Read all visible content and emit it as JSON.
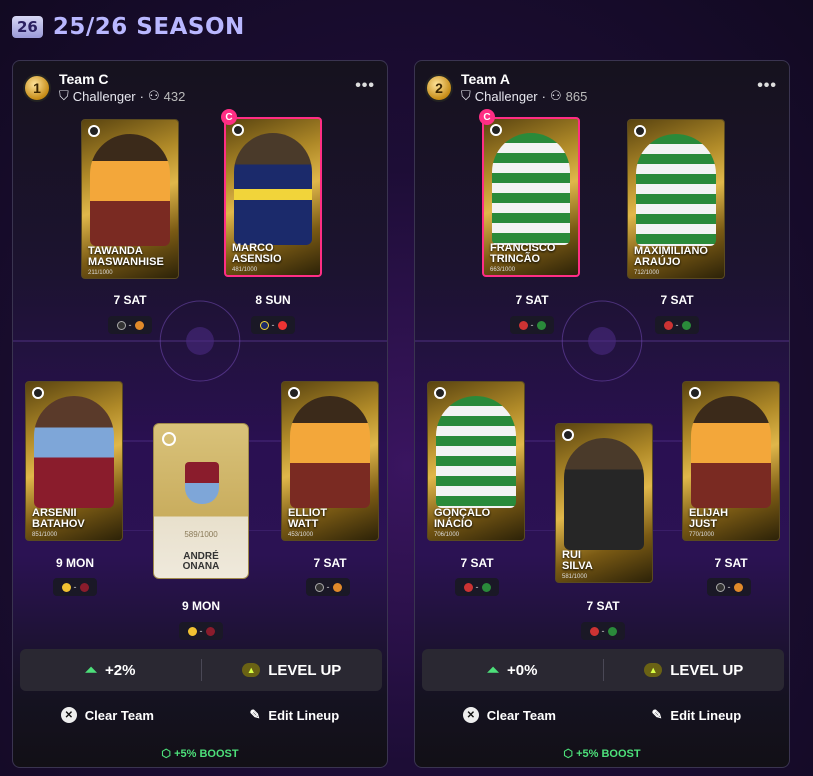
{
  "season": {
    "badge": "26",
    "title": "25/26 SEASON"
  },
  "teams": [
    {
      "rank": "1",
      "name": "Team C",
      "tier": "Challenger",
      "separator": "·",
      "members": "432",
      "more": "•••",
      "players": [
        {
          "first": "TAWANDA",
          "last": "MASWANHISE",
          "serial": "211/1000",
          "day": "7 SAT",
          "fixture_sep": "-"
        },
        {
          "first": "MARCO",
          "last": "ASENSIO",
          "serial": "481/1000",
          "day": "8 SUN",
          "fixture_sep": "-",
          "captain": "C"
        },
        {
          "first": "ARSENII",
          "last": "BATAHOV",
          "serial": "851/1000",
          "day": "9 MON",
          "fixture_sep": "-"
        },
        {
          "first": "ANDRÉ",
          "last": "ONANA",
          "serial": "589/1000",
          "day": "9 MON",
          "fixture_sep": "-"
        },
        {
          "first": "ELLIOT",
          "last": "WATT",
          "serial": "453/1000",
          "day": "7 SAT",
          "fixture_sep": "-"
        }
      ],
      "bonus": "+2%",
      "level_up": "LEVEL UP",
      "clear": "Clear Team",
      "edit": "Edit Lineup",
      "boost": "+5% BOOST"
    },
    {
      "rank": "2",
      "name": "Team A",
      "tier": "Challenger",
      "separator": "·",
      "members": "865",
      "more": "•••",
      "players": [
        {
          "first": "FRANCISCO",
          "last": "TRINCÃO",
          "serial": "663/1000",
          "day": "7 SAT",
          "fixture_sep": "-",
          "captain": "C"
        },
        {
          "first": "MAXIMILIANO",
          "last": "ARAÚJO",
          "serial": "712/1000",
          "day": "7 SAT",
          "fixture_sep": "-"
        },
        {
          "first": "GONÇALO",
          "last": "INÁCIO",
          "serial": "706/1000",
          "day": "7 SAT",
          "fixture_sep": "-"
        },
        {
          "first": "RUI",
          "last": "SILVA",
          "serial": "581/1000",
          "day": "7 SAT",
          "fixture_sep": "-"
        },
        {
          "first": "ELIJAH",
          "last": "JUST",
          "serial": "770/1000",
          "day": "7 SAT",
          "fixture_sep": "-"
        }
      ],
      "bonus": "+0%",
      "level_up": "LEVEL UP",
      "clear": "Clear Team",
      "edit": "Edit Lineup",
      "boost": "+5% BOOST"
    }
  ]
}
